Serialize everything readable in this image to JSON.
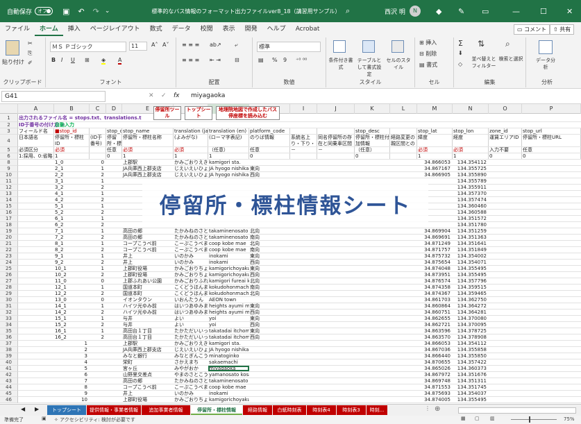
{
  "window": {
    "autosave_label": "自動保存",
    "autosave_state": "オフ",
    "title": "標準的なバス情報のフォーマット出力ファイルver8_18（講習用サンプル）.xlsm ∨",
    "user_name": "西沢 明",
    "user_initial": "N"
  },
  "menu": {
    "tabs": [
      "ファイル",
      "ホーム",
      "挿入",
      "ページレイアウト",
      "数式",
      "データ",
      "校閲",
      "表示",
      "開発",
      "ヘルプ",
      "Acrobat"
    ],
    "active": "ホーム",
    "comment_label": "コメント",
    "share_label": "共有"
  },
  "ribbon": {
    "clipboard": {
      "paste": "貼り付け",
      "label": "クリップボード"
    },
    "font": {
      "name": "ＭＳ Ｐゴシック",
      "size": "11",
      "label": "フォント"
    },
    "align": {
      "label": "配置"
    },
    "number": {
      "format": "標準",
      "label": "数値"
    },
    "styles": {
      "cond": "条件付き書式",
      "table": "テーブルとして書式設定",
      "cell": "セルのスタイル",
      "label": "スタイル"
    },
    "cells": {
      "insert": "挿入",
      "delete": "削除",
      "format": "書式",
      "label": "セル"
    },
    "editing": {
      "sort": "並べ替えとフィルター",
      "find": "検索と選択",
      "label": "編集"
    },
    "analysis": {
      "btn": "データ分析",
      "label": "分析"
    }
  },
  "formula_bar": {
    "cell": "G41",
    "fx": "fx",
    "value": "miyagaoka"
  },
  "columns": [
    "A",
    "B",
    "C",
    "D",
    "E",
    "F",
    "G",
    "H",
    "I",
    "J",
    "K",
    "L",
    "M",
    "N",
    "O",
    "P"
  ],
  "header": {
    "r1_text": "出力されるファイル名 = stops.txt、translations.t",
    "r2_text": "ID于番号の付け方 =",
    "r2_value": "自動入力",
    "btn_stop_tool": "停留所ツール",
    "btn_top_sheet": "トップシート",
    "btn_map": "地理院地図で作成したバス停座標を読み込む",
    "r3": [
      "フィールド名",
      "■stop_id",
      "",
      "stop_code",
      "stop_name",
      "translation (ja-Hrkt)",
      "translation (en)",
      "platform_code",
      "",
      "",
      "stop_desc",
      "",
      "stop_lat",
      "stop_lon",
      "zone_id",
      "stop_url"
    ],
    "r4": [
      "日本語名",
      "停留所・標柱ID",
      "(ID于番号)",
      "停留所・標柱番号",
      "停留所・標柱名称",
      "(よみがな)",
      "(ローマ字表記)",
      "のりば情報",
      "",
      "",
      "停留所・標柱付加情報",
      "",
      "緯度",
      "経度",
      "運賃エリアID",
      "停留所・標柱URL"
    ],
    "r4_i": "系統名上り・下り・順路等の区分、乗り場等",
    "r4_j": "同名停留所の存在と同乗車区間と方向",
    "r4_k": "停留所・標柱付加情報",
    "r4_l": "経路変更の親区間との自動対応",
    "r5": [
      "必須区分",
      "必須",
      "",
      "任意",
      "必須",
      "必須",
      "（任意）",
      "任意",
      "－",
      "－",
      "（任意）",
      "",
      "必須",
      "必須",
      "入力不要",
      "任意"
    ],
    "r6": [
      "1:採用、0:省略",
      "1",
      "",
      "0",
      "1",
      "1",
      "1",
      "0",
      "",
      "",
      "0",
      "",
      "1",
      "1",
      "0",
      "0"
    ]
  },
  "row_numbers": [
    "1",
    "2",
    "3",
    "4",
    "5",
    "6",
    "8",
    "9",
    "10",
    "11",
    "12",
    "13",
    "14",
    "15",
    "16",
    "17",
    "18",
    "19",
    "20",
    "21",
    "22",
    "23",
    "24",
    "25",
    "26",
    "27",
    "28",
    "29",
    "30",
    "31",
    "32",
    "33",
    "34",
    "35",
    "36",
    "37",
    "38",
    "39",
    "40",
    "41",
    "42",
    "43",
    "44",
    "45",
    "46"
  ],
  "rows": [
    [
      "1_0",
      "0",
      "上郡駅",
      "かみごおりえき",
      "kamigori sta.",
      "",
      "34.866053",
      "134.354112"
    ],
    [
      "2_1",
      "1",
      "JA兵庫西上郡支店",
      "じえいえいひょうごに",
      "JA hyogo nishikamigori shiten",
      "東向",
      "34.867167",
      "134.355725"
    ],
    [
      "2_2",
      "2",
      "JA兵庫西上郡支店",
      "じえいえいひょうごに",
      "JA hyogo nishikamigori shiten",
      "西向",
      "34.866905",
      "134.355890"
    ],
    [
      "3_1",
      "1",
      "",
      "",
      "",
      "",
      "",
      "134.355789"
    ],
    [
      "3_2",
      "2",
      "",
      "",
      "",
      "",
      "",
      "134.355911"
    ],
    [
      "4_1",
      "1",
      "",
      "",
      "",
      "",
      "",
      "134.357370"
    ],
    [
      "4_2",
      "2",
      "",
      "",
      "",
      "",
      "",
      "134.357474"
    ],
    [
      "5_1",
      "1",
      "",
      "",
      "",
      "",
      "",
      "134.360460"
    ],
    [
      "5_2",
      "2",
      "",
      "",
      "",
      "",
      "",
      "134.360588"
    ],
    [
      "6_1",
      "1",
      "",
      "",
      "",
      "",
      "",
      "134.351572"
    ],
    [
      "6_2",
      "2",
      "",
      "",
      "",
      "",
      "",
      "134.351780"
    ],
    [
      "7_1",
      "1",
      "高田の郷",
      "たかみねのさと",
      "takaminenosato",
      "北向",
      "34.869904",
      "134.351259"
    ],
    [
      "7_2",
      "2",
      "高田の郷",
      "たかみねのさと",
      "takaminenosato",
      "南向",
      "34.869691",
      "134.351363"
    ],
    [
      "8_1",
      "1",
      "コープこうべ前",
      "こーぷこうべまえ",
      "coop kobe mae",
      "北向",
      "34.871249",
      "134.351641"
    ],
    [
      "8_2",
      "2",
      "コープこうべ前",
      "こーぷこうべまえ",
      "coop kobe mae",
      "南向",
      "34.871757",
      "134.351849"
    ],
    [
      "9_1",
      "1",
      "井上",
      "いのかみ",
      "inokami",
      "東向",
      "34.875732",
      "134.354002"
    ],
    [
      "9_2",
      "2",
      "井上",
      "いのかみ",
      "inokami",
      "西向",
      "34.875654",
      "134.354071"
    ],
    [
      "10_1",
      "1",
      "上郡町役場",
      "かみごおりちょうやく",
      "kamigorichoyakuba",
      "東向",
      "34.874048",
      "134.355495"
    ],
    [
      "10_2",
      "2",
      "上郡町役場",
      "かみごおりちょうやく",
      "kamigorichoyakuba",
      "西向",
      "34.873951",
      "134.355495"
    ],
    [
      "11_0",
      "0",
      "上郡ふれあい公園",
      "かみごおりふれあい",
      "kamigori fureai koen",
      "北向",
      "34.876574",
      "134.357796"
    ],
    [
      "12_1",
      "1",
      "国道本町",
      "こくどうほんまち",
      "kokudohonmachi",
      "南向",
      "34.874358",
      "134.359515"
    ],
    [
      "12_2",
      "2",
      "国道本町",
      "こくどうほんまち",
      "kokudohonmachi",
      "北向",
      "34.874367",
      "134.359465"
    ],
    [
      "13_0",
      "0",
      "イオンタウン",
      "いおんたうん",
      "AEON town",
      "",
      "34.861703",
      "134.362750"
    ],
    [
      "14_1",
      "1",
      "ハイツ光ゆみ前",
      "はいつあゆみまえ",
      "heights ayumi mae",
      "東向",
      "34.860864",
      "134.364272"
    ],
    [
      "14_2",
      "2",
      "ハイツ光ゆみ前",
      "はいつあゆみまえ",
      "heights ayumi mae",
      "西向",
      "34.860751",
      "134.364281"
    ],
    [
      "15_1",
      "1",
      "与井",
      "よい",
      "yoi",
      "東向",
      "34.862655",
      "134.370080"
    ],
    [
      "15_2",
      "2",
      "与井",
      "よい",
      "yoi",
      "西向",
      "34.862721",
      "134.370095"
    ],
    [
      "16_1",
      "1",
      "高田台１丁目",
      "たかただいいっちょう",
      "takatadai itchome",
      "東向",
      "34.863596",
      "134.378725"
    ],
    [
      "16_2",
      "2",
      "高田台１丁目",
      "たかただいいっちょう",
      "takatadai itchome",
      "西向",
      "34.863570",
      "134.378908"
    ],
    [
      "1",
      "1",
      "上郡駅",
      "かみごおりえき",
      "kamigori sta.",
      "",
      "34.866053",
      "134.354112"
    ],
    [
      "2",
      "2",
      "JA兵庫西上郡支店",
      "じえいえいひょうごに",
      "JA hyogo nishikamigori shiten",
      "",
      "34.867036",
      "134.355858"
    ],
    [
      "3",
      "3",
      "みなと銀行",
      "みなとぎんこう",
      "minatoginko",
      "",
      "34.866440",
      "134.355850"
    ],
    [
      "4",
      "4",
      "栄町",
      "さかえまち",
      "sakaemachi",
      "",
      "34.870655",
      "134.357422"
    ],
    [
      "5",
      "5",
      "宮ヶ丘",
      "みやがおか",
      "miyagaoka",
      "",
      "34.865026",
      "134.360373"
    ],
    [
      "6",
      "6",
      "山野里交差点",
      "やまのさとこうさてん",
      "yamanosato kosaten",
      "",
      "34.867972",
      "134.351676"
    ],
    [
      "7",
      "7",
      "高田の郷",
      "たかみねのさと",
      "takaminenosato",
      "",
      "34.869748",
      "134.351311"
    ],
    [
      "8",
      "8",
      "コープこうべ前",
      "こーぷこうべまえ",
      "coop kobe mae",
      "",
      "34.871553",
      "134.351745"
    ],
    [
      "9",
      "9",
      "井上",
      "いのかみ",
      "inokami",
      "",
      "34.875693",
      "134.354037"
    ],
    [
      "10",
      "10",
      "上郡町役場",
      "かみごおりちょうやく",
      "kamigorichoyakuba",
      "",
      "34.874005",
      "134.355495"
    ]
  ],
  "overlay_text": "停留所・標柱情報シート",
  "sheet_tabs": [
    "トップシート",
    "提供情報・事業者情報",
    "追加事業者情報",
    "停留所・標柱情報",
    "経路情報",
    "白紙時刻表",
    "時刻表4",
    "時刻表3",
    "時刻..."
  ],
  "sheet_tab_colors": [
    "#2e75b6",
    "#c00000",
    "#c00000",
    "#70ad47",
    "#c00000",
    "#c00000",
    "#c00000",
    "#c00000",
    "#c00000"
  ],
  "status": {
    "ready": "準備完了",
    "accessibility": "アクセシビリティ: 検討が必要です",
    "zoom": "75%"
  }
}
